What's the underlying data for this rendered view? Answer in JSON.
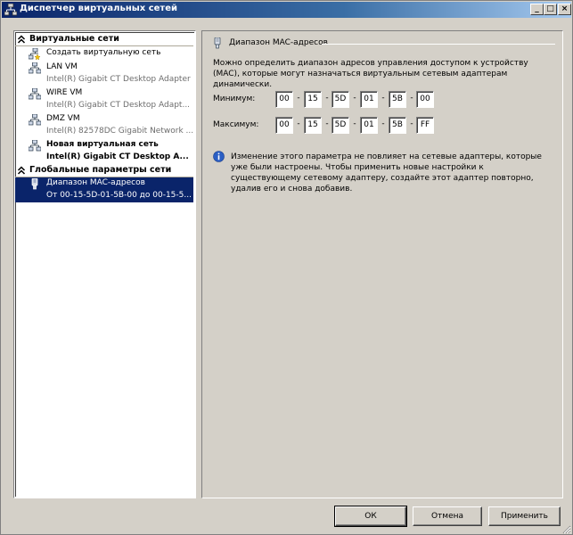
{
  "window": {
    "title": "Диспетчер виртуальных сетей",
    "minimize_glyph": "_",
    "maximize_glyph": "□",
    "close_glyph": "×"
  },
  "left": {
    "virtual_networks_header": "Виртуальные сети",
    "items": [
      {
        "line1": "Создать виртуальную сеть",
        "icon": "new-network-icon"
      },
      {
        "line1": "LAN VM",
        "line2": "Intel(R) Gigabit CT Desktop Adapter",
        "icon": "network-icon"
      },
      {
        "line1": "WIRE VM",
        "line2": "Intel(R) Gigabit CT Desktop Adapt...",
        "icon": "network-icon"
      },
      {
        "line1": "DMZ VM",
        "line2": "Intel(R) 82578DC Gigabit Network ...",
        "icon": "network-icon"
      },
      {
        "line1": "Новая виртуальная сеть",
        "line2": "Intel(R) Gigabit CT Desktop A...",
        "icon": "network-icon"
      }
    ],
    "global_header": "Глобальные параметры сети",
    "global_items": [
      {
        "line1": "Диапазон MAC-адресов",
        "line2": "От 00-15-5D-01-5B-00 до 00-15-5...",
        "icon": "mac-range-icon"
      }
    ]
  },
  "right": {
    "header": "Диапазон MAC-адресов",
    "description": "Можно определить диапазон адресов управления доступом к устройству (MAC), которые могут назначаться виртуальным сетевым адаптерам динамически.",
    "min_label": "Минимум:",
    "max_label": "Максимум:",
    "min_octets": [
      "00",
      "15",
      "5D",
      "01",
      "5B",
      "00"
    ],
    "max_octets": [
      "00",
      "15",
      "5D",
      "01",
      "5B",
      "FF"
    ],
    "separator": "-",
    "info_text": "Изменение этого параметра не повлияет на сетевые адаптеры, которые уже были настроены.  Чтобы применить новые настройки к существующему сетевому адаптеру, создайте этот адаптер повторно, удалив его и снова добавив."
  },
  "buttons": {
    "ok": "ОК",
    "cancel": "Отмена",
    "apply": "Применить"
  },
  "colors": {
    "selection": "#0a246a",
    "title_bar_start": "#0a246a",
    "face": "#d4d0c8"
  }
}
